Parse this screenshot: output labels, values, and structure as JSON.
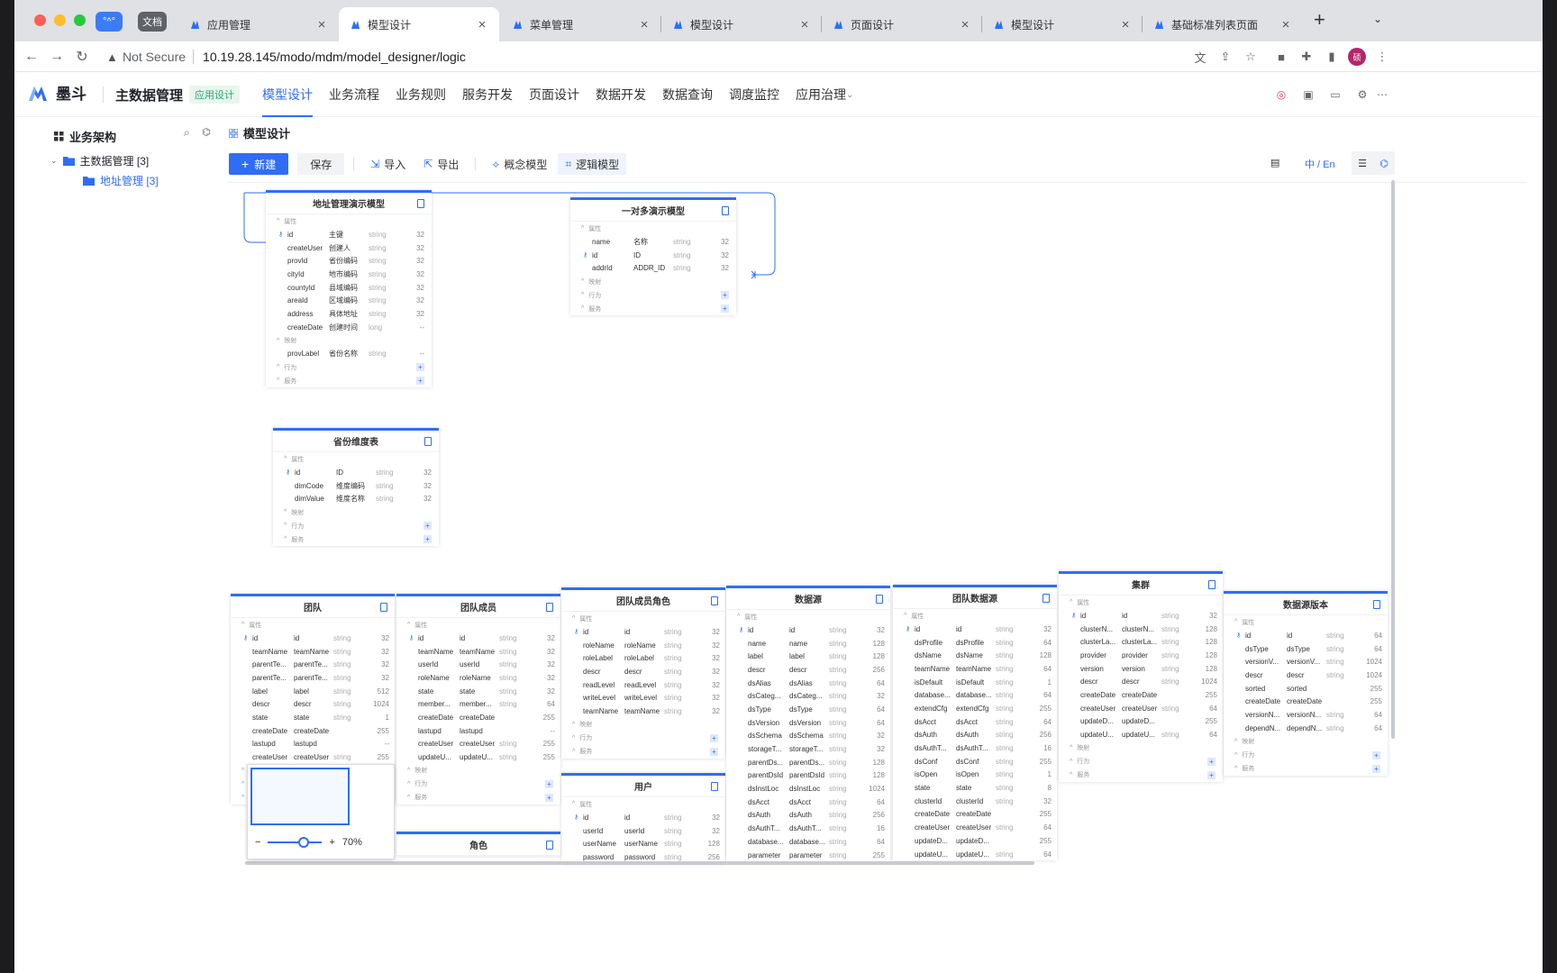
{
  "browser": {
    "pills": [
      {
        "label": "°^°",
        "color": "#3b7cf5"
      },
      {
        "label": "文档",
        "color": "#5f6368"
      }
    ],
    "tabs": [
      {
        "title": "应用管理",
        "active": false
      },
      {
        "title": "模型设计",
        "active": true
      },
      {
        "title": "菜单管理",
        "active": false
      },
      {
        "title": "模型设计",
        "active": false
      },
      {
        "title": "页面设计",
        "active": false
      },
      {
        "title": "模型设计",
        "active": false
      },
      {
        "title": "基础标准列表页面",
        "active": false
      }
    ],
    "not_secure": "Not Secure",
    "url": "10.19.28.145/modo/mdm/model_designer/logic",
    "avatar_color": "#b5266b"
  },
  "app": {
    "logo_text": "墨斗",
    "system_name": "主数据管理",
    "tag": "应用设计",
    "nav": [
      "模型设计",
      "业务流程",
      "业务规则",
      "服务开发",
      "页面设计",
      "数据开发",
      "数据查询",
      "调度监控",
      "应用治理"
    ],
    "nav_active": 0
  },
  "sidebar": {
    "title": "业务架构",
    "root": "主数据管理 [3]",
    "child": "地址管理 [3]"
  },
  "main": {
    "title": "模型设计",
    "toolbar": {
      "new": "新建",
      "save": "保存",
      "import": "导入",
      "export": "导出",
      "concept": "概念模型",
      "logic": "逻辑模型",
      "lang": "中 / En"
    },
    "zoom": "70%"
  },
  "entities": [
    {
      "name": "地址管理演示模型",
      "sections": {
        "attr": "属性",
        "map": "映射",
        "act": "行为",
        "svc": "服务"
      },
      "rows": [
        [
          "id",
          "主键",
          "string",
          "32",
          1
        ],
        [
          "createUser",
          "创建人",
          "string",
          "32",
          0
        ],
        [
          "provId",
          "省份编码",
          "string",
          "32",
          0
        ],
        [
          "cityId",
          "地市编码",
          "string",
          "32",
          0
        ],
        [
          "countyId",
          "县域编码",
          "string",
          "32",
          0
        ],
        [
          "areaId",
          "区域编码",
          "string",
          "32",
          0
        ],
        [
          "address",
          "具体地址",
          "string",
          "32",
          0
        ],
        [
          "createDate",
          "创建时间",
          "long",
          "--",
          0
        ]
      ],
      "maps": [
        [
          "provLabel",
          "省份名称",
          "string",
          "--",
          0
        ]
      ]
    },
    {
      "name": "一对多演示模型",
      "sections": {
        "attr": "属性",
        "map": "映射",
        "act": "行为",
        "svc": "服务"
      },
      "rows": [
        [
          "name",
          "名称",
          "string",
          "32",
          0
        ],
        [
          "id",
          "ID",
          "string",
          "32",
          1
        ],
        [
          "addrId",
          "ADDR_ID",
          "string",
          "32",
          0
        ]
      ],
      "maps": []
    },
    {
      "name": "省份维度表",
      "sections": {
        "attr": "属性",
        "map": "映射",
        "act": "行为",
        "svc": "服务"
      },
      "rows": [
        [
          "id",
          "ID",
          "string",
          "32",
          1
        ],
        [
          "dimCode",
          "维度编码",
          "string",
          "32",
          0
        ],
        [
          "dimValue",
          "维度名称",
          "string",
          "32",
          0
        ]
      ],
      "maps": []
    },
    {
      "name": "团队",
      "sections": {
        "attr": "属性",
        "map": "映射",
        "act": "行为",
        "svc": "服务"
      },
      "rows": [
        [
          "id",
          "id",
          "string",
          "32",
          1
        ],
        [
          "teamName",
          "teamName",
          "string",
          "32",
          0
        ],
        [
          "parentTe...",
          "parentTe...",
          "string",
          "32",
          0
        ],
        [
          "parentTe...",
          "parentTe...",
          "string",
          "32",
          0
        ],
        [
          "label",
          "label",
          "string",
          "512",
          0
        ],
        [
          "descr",
          "descr",
          "string",
          "1024",
          0
        ],
        [
          "state",
          "state",
          "string",
          "1",
          0
        ],
        [
          "createDate",
          "createDate",
          "",
          "255",
          0
        ],
        [
          "lastupd",
          "lastupd",
          "",
          "--",
          0
        ],
        [
          "createUser",
          "createUser",
          "string",
          "255",
          0
        ]
      ],
      "maps": []
    },
    {
      "name": "团队成员",
      "sections": {
        "attr": "属性",
        "map": "映射",
        "act": "行为",
        "svc": "服务"
      },
      "rows": [
        [
          "id",
          "id",
          "string",
          "32",
          1
        ],
        [
          "teamName",
          "teamName",
          "string",
          "32",
          0
        ],
        [
          "userId",
          "userId",
          "string",
          "32",
          0
        ],
        [
          "roleName",
          "roleName",
          "string",
          "32",
          0
        ],
        [
          "state",
          "state",
          "string",
          "32",
          0
        ],
        [
          "member...",
          "member...",
          "string",
          "64",
          0
        ],
        [
          "createDate",
          "createDate",
          "",
          "255",
          0
        ],
        [
          "lastupd",
          "lastupd",
          "",
          "--",
          0
        ],
        [
          "createUser",
          "createUser",
          "string",
          "255",
          0
        ],
        [
          "updateU...",
          "updateU...",
          "string",
          "255",
          0
        ]
      ],
      "maps": []
    },
    {
      "name": "团队成员角色",
      "sections": {
        "attr": "属性",
        "map": "映射",
        "act": "行为",
        "svc": "服务"
      },
      "rows": [
        [
          "id",
          "id",
          "string",
          "32",
          1
        ],
        [
          "roleName",
          "roleName",
          "string",
          "32",
          0
        ],
        [
          "roleLabel",
          "roleLabel",
          "string",
          "32",
          0
        ],
        [
          "descr",
          "descr",
          "string",
          "32",
          0
        ],
        [
          "readLevel",
          "readLevel",
          "string",
          "32",
          0
        ],
        [
          "writeLevel",
          "writeLevel",
          "string",
          "32",
          0
        ],
        [
          "teamName",
          "teamName",
          "string",
          "32",
          0
        ]
      ],
      "maps": []
    },
    {
      "name": "用户",
      "sections": {
        "attr": "属性"
      },
      "rows": [
        [
          "id",
          "id",
          "string",
          "32",
          1
        ],
        [
          "userId",
          "userId",
          "string",
          "32",
          0
        ],
        [
          "userName",
          "userName",
          "string",
          "128",
          0
        ],
        [
          "password",
          "password",
          "string",
          "256",
          0
        ]
      ],
      "maps": []
    },
    {
      "name": "数据源",
      "sections": {
        "attr": "属性"
      },
      "rows": [
        [
          "id",
          "id",
          "string",
          "32",
          1
        ],
        [
          "name",
          "name",
          "string",
          "128",
          0
        ],
        [
          "label",
          "label",
          "string",
          "128",
          0
        ],
        [
          "descr",
          "descr",
          "string",
          "256",
          0
        ],
        [
          "dsAlias",
          "dsAlias",
          "string",
          "64",
          0
        ],
        [
          "dsCateg...",
          "dsCateg...",
          "string",
          "32",
          0
        ],
        [
          "dsType",
          "dsType",
          "string",
          "64",
          0
        ],
        [
          "dsVersion",
          "dsVersion",
          "string",
          "64",
          0
        ],
        [
          "dsSchema",
          "dsSchema",
          "string",
          "32",
          0
        ],
        [
          "storageT...",
          "storageT...",
          "string",
          "32",
          0
        ],
        [
          "parentDs...",
          "parentDs...",
          "string",
          "128",
          0
        ],
        [
          "parentDsId",
          "parentDsId",
          "string",
          "128",
          0
        ],
        [
          "dsInstLoc",
          "dsInstLoc",
          "string",
          "1024",
          0
        ],
        [
          "dsAcct",
          "dsAcct",
          "string",
          "64",
          0
        ],
        [
          "dsAuth",
          "dsAuth",
          "string",
          "256",
          0
        ],
        [
          "dsAuthT...",
          "dsAuthT...",
          "string",
          "16",
          0
        ],
        [
          "database...",
          "database...",
          "string",
          "64",
          0
        ],
        [
          "parameter",
          "parameter",
          "string",
          "255",
          0
        ]
      ],
      "maps": []
    },
    {
      "name": "团队数据源",
      "sections": {
        "attr": "属性"
      },
      "rows": [
        [
          "id",
          "id",
          "string",
          "32",
          1
        ],
        [
          "dsProfile",
          "dsProfile",
          "string",
          "64",
          0
        ],
        [
          "dsName",
          "dsName",
          "string",
          "128",
          0
        ],
        [
          "teamName",
          "teamName",
          "string",
          "64",
          0
        ],
        [
          "isDefault",
          "isDefault",
          "string",
          "1",
          0
        ],
        [
          "database...",
          "database...",
          "string",
          "64",
          0
        ],
        [
          "extendCfg",
          "extendCfg",
          "string",
          "255",
          0
        ],
        [
          "dsAcct",
          "dsAcct",
          "string",
          "64",
          0
        ],
        [
          "dsAuth",
          "dsAuth",
          "string",
          "256",
          0
        ],
        [
          "dsAuthT...",
          "dsAuthT...",
          "string",
          "16",
          0
        ],
        [
          "dsConf",
          "dsConf",
          "string",
          "255",
          0
        ],
        [
          "isOpen",
          "isOpen",
          "string",
          "1",
          0
        ],
        [
          "state",
          "state",
          "string",
          "8",
          0
        ],
        [
          "clusterId",
          "clusterId",
          "string",
          "32",
          0
        ],
        [
          "createDate",
          "createDate",
          "",
          "255",
          0
        ],
        [
          "createUser",
          "createUser",
          "string",
          "64",
          0
        ],
        [
          "updateD...",
          "updateD...",
          "",
          "255",
          0
        ],
        [
          "updateU...",
          "updateU...",
          "string",
          "64",
          0
        ]
      ],
      "maps": []
    },
    {
      "name": "集群",
      "sections": {
        "attr": "属性",
        "map": "映射",
        "act": "行为",
        "svc": "服务"
      },
      "rows": [
        [
          "id",
          "id",
          "string",
          "32",
          1
        ],
        [
          "clusterN...",
          "clusterN...",
          "string",
          "128",
          0
        ],
        [
          "clusterLa...",
          "clusterLa...",
          "string",
          "128",
          0
        ],
        [
          "provider",
          "provider",
          "string",
          "128",
          0
        ],
        [
          "version",
          "version",
          "string",
          "128",
          0
        ],
        [
          "descr",
          "descr",
          "string",
          "1024",
          0
        ],
        [
          "createDate",
          "createDate",
          "",
          "255",
          0
        ],
        [
          "createUser",
          "createUser",
          "string",
          "64",
          0
        ],
        [
          "updateD...",
          "updateD...",
          "",
          "255",
          0
        ],
        [
          "updateU...",
          "updateU...",
          "string",
          "64",
          0
        ]
      ],
      "maps": []
    },
    {
      "name": "数据源版本",
      "sections": {
        "attr": "属性",
        "map": "映射",
        "act": "行为",
        "svc": "服务"
      },
      "rows": [
        [
          "id",
          "id",
          "string",
          "64",
          1
        ],
        [
          "dsType",
          "dsType",
          "string",
          "64",
          0
        ],
        [
          "versionV...",
          "versionV...",
          "string",
          "1024",
          0
        ],
        [
          "descr",
          "descr",
          "string",
          "1024",
          0
        ],
        [
          "sorted",
          "sorted",
          "",
          "255",
          0
        ],
        [
          "createDate",
          "createDate",
          "",
          "255",
          0
        ],
        [
          "versionN...",
          "versionN...",
          "string",
          "64",
          0
        ],
        [
          "dependN...",
          "dependN...",
          "string",
          "64",
          0
        ]
      ],
      "maps": []
    },
    {
      "name": "角色",
      "sections": {},
      "rows": [],
      "maps": []
    }
  ]
}
